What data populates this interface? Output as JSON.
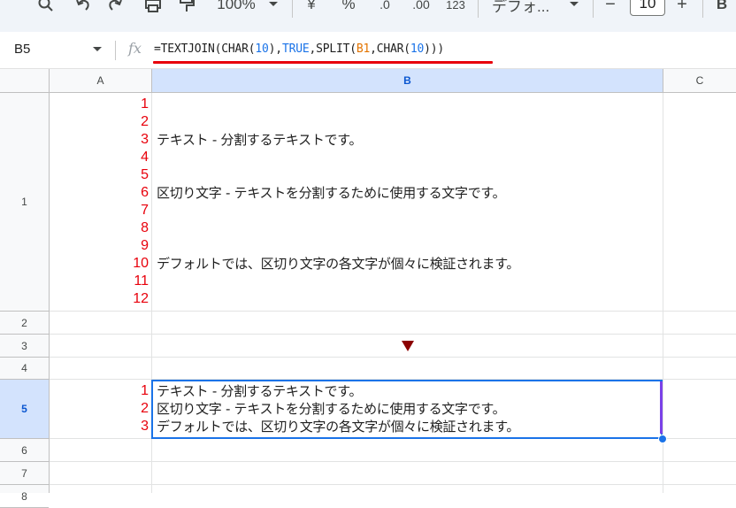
{
  "toolbar": {
    "zoom": "100%",
    "currency": "¥",
    "percent": "%",
    "dec_decrease": ".0",
    "dec_increase": ".00",
    "format_123": "123",
    "font": "デフォ...",
    "font_size": "10",
    "minus": "−",
    "plus": "+",
    "bold": "B"
  },
  "formula_bar": {
    "cell_ref": "B5",
    "fx": "fx",
    "formula_parts": [
      "=TEXTJOIN(CHAR(",
      "10",
      "),",
      "TRUE",
      ",SPLIT(",
      "B1",
      ",CHAR(",
      "10",
      ")))"
    ]
  },
  "columns": [
    "A",
    "B",
    "C"
  ],
  "rows": [
    "1",
    "2",
    "3",
    "4",
    "5",
    "6",
    "7",
    "8"
  ],
  "cells": {
    "A1_numbers": [
      "1",
      "2",
      "3",
      "4",
      "5",
      "6",
      "7",
      "8",
      "9",
      "10",
      "11",
      "12"
    ],
    "B1_lines": [
      "テキスト - 分割するテキストです。",
      "区切り文字 - テキストを分割するために使用する文字です。",
      "デフォルトでは、区切り文字の各文字が個々に検証されます。"
    ],
    "A5_numbers": [
      "1",
      "2",
      "3"
    ],
    "B5_lines": [
      "テキスト - 分割するテキストです。",
      "区切り文字 - テキストを分割するために使用する文字です。",
      "デフォルトでは、区切り文字の各文字が個々に検証されます。"
    ]
  },
  "colors": {
    "accent": "#1a73e8",
    "red_numbers": "#e8000b",
    "arrow": "#8b0000",
    "header_selected": "#d3e3fd"
  }
}
